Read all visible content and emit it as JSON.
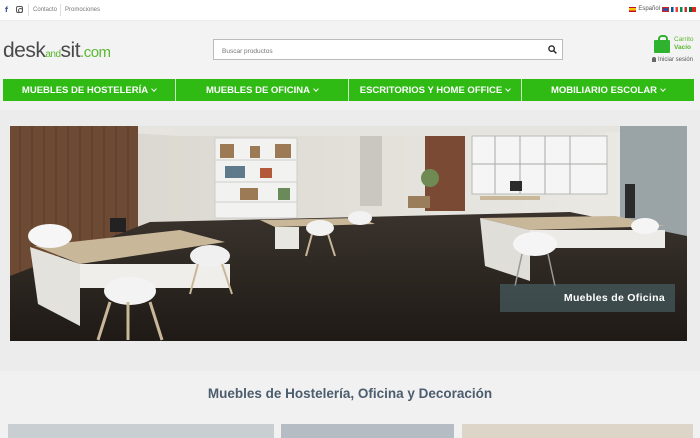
{
  "topbar": {
    "social": [
      "facebook-icon",
      "instagram-icon"
    ],
    "links": [
      "Contacto",
      "Promociones"
    ],
    "language": "Español",
    "flags": [
      "spain-flag",
      "uk-flag",
      "france-flag",
      "italy-flag",
      "portugal-flag"
    ]
  },
  "header": {
    "logo": {
      "desk": "desk",
      "and": "and",
      "sit": "sit",
      "dotcom": ".com"
    },
    "search": {
      "placeholder": "Buscar productos"
    },
    "cart": {
      "label": "Carrito",
      "status": "Vacío"
    },
    "login": "Iniciar sesión"
  },
  "nav": {
    "items": [
      "MUEBLES DE HOSTELERÍA",
      "MUEBLES DE OFICINA",
      "ESCRITORIOS Y HOME OFFICE",
      "MOBILIARIO ESCOLAR"
    ]
  },
  "hero": {
    "caption": "Muebles de Oficina"
  },
  "section": {
    "title": "Muebles de Hostelería, Oficina y Decoración"
  },
  "colors": {
    "accent": "#2fba14",
    "logo_green": "#5ab82f",
    "title": "#4b5d6e"
  }
}
